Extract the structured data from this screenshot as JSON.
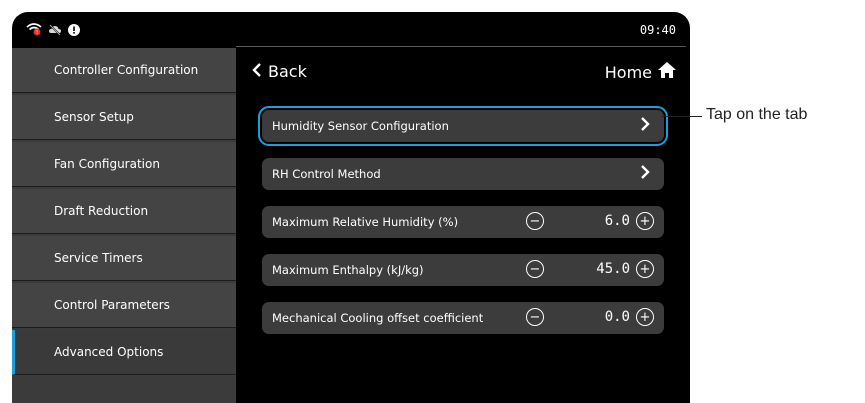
{
  "status_bar": {
    "time": "09:40",
    "icons": [
      "wifi-alert-icon",
      "cloud-off-icon",
      "alert-icon"
    ]
  },
  "sidebar": {
    "items": [
      {
        "label": "Controller Configuration"
      },
      {
        "label": "Sensor Setup"
      },
      {
        "label": "Fan Configuration"
      },
      {
        "label": "Draft Reduction"
      },
      {
        "label": "Service Timers"
      },
      {
        "label": "Control Parameters"
      },
      {
        "label": "Advanced Options"
      }
    ],
    "active_index": 6
  },
  "nav": {
    "back_label": "Back",
    "home_label": "Home"
  },
  "rows": [
    {
      "label": "Humidity Sensor Configuration",
      "type": "link"
    },
    {
      "label": "RH Control Method",
      "type": "link"
    },
    {
      "label": "Maximum Relative Humidity (%)",
      "type": "stepper",
      "value": "6.0"
    },
    {
      "label": "Maximum Enthalpy (kJ/kg)",
      "type": "stepper",
      "value": "45.0"
    },
    {
      "label": "Mechanical Cooling offset coefficient",
      "type": "stepper",
      "value": "0.0"
    }
  ],
  "callout": {
    "text": "Tap on the tab"
  },
  "colors": {
    "accent": "#1a9fd8",
    "background": "#000000",
    "sidebar": "#444444",
    "row": "#3c3c3c"
  }
}
